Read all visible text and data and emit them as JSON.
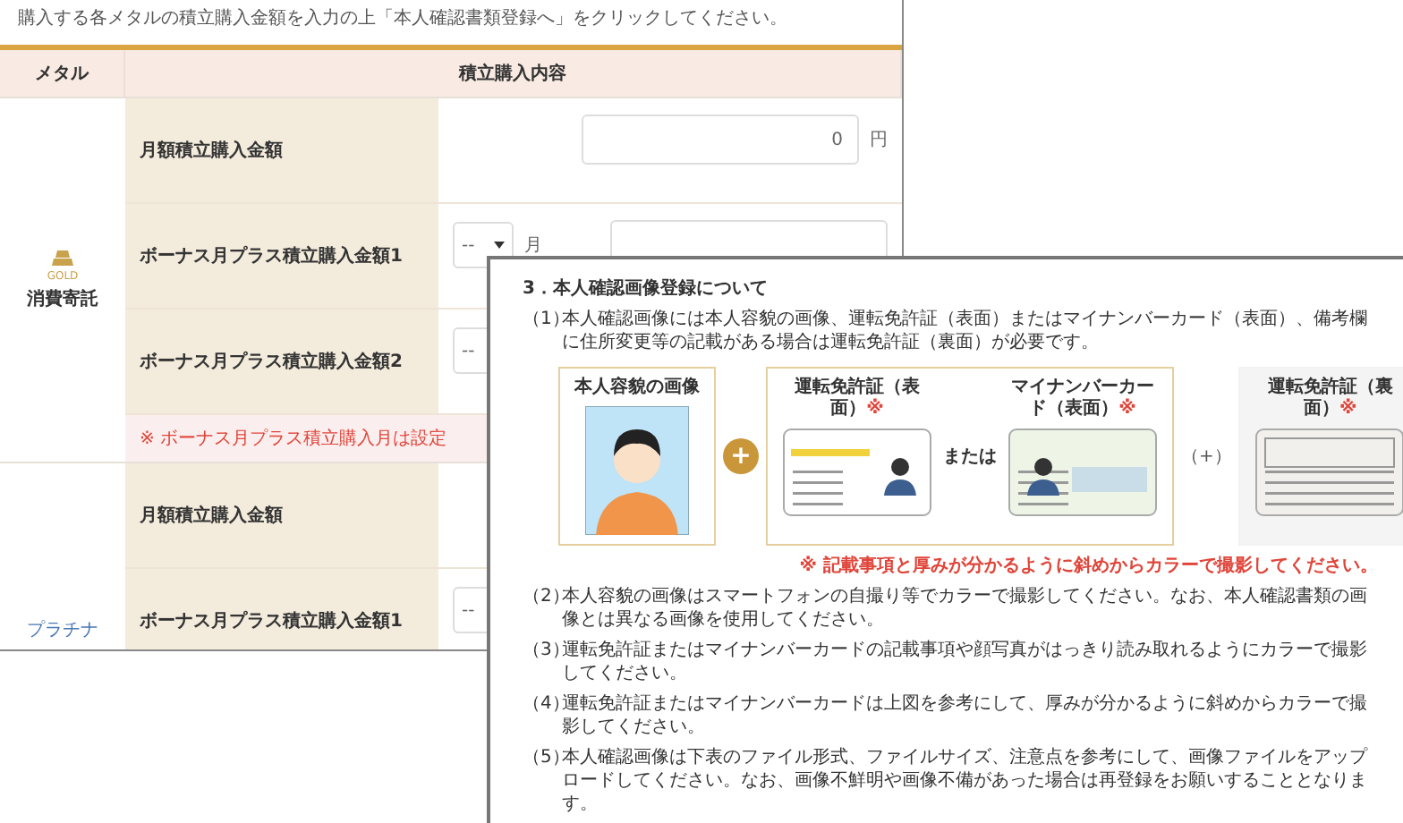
{
  "back_window": {
    "instruction": "購入する各メタルの積立購入金額を入力の上「本人確認書類登録へ」をクリックしてください。",
    "columns": [
      "メタル",
      "積立購入内容"
    ],
    "metals": [
      {
        "kind": "gold",
        "badge": "GOLD",
        "name": "消費寄託",
        "rows": [
          {
            "label": "月額積立購入金額",
            "kind": "amount",
            "amount_box": true,
            "amount": "0",
            "unit": "円"
          },
          {
            "label": "ボーナス月プラス積立購入金額1",
            "kind": "bonus",
            "month": "--",
            "month_unit": "月",
            "amount_box": true
          },
          {
            "label": "ボーナス月プラス積立購入金額2",
            "kind": "bonus",
            "month": "--",
            "amount_box": false
          }
        ],
        "note": "※ ボーナス月プラス積立購入月は設定"
      },
      {
        "kind": "platinum",
        "name": "プラチナ",
        "rows": [
          {
            "label": "月額積立購入金額",
            "kind": "amount",
            "amount_box": false
          },
          {
            "label": "ボーナス月プラス積立購入金額1",
            "kind": "bonus",
            "month": "--",
            "amount_box": false
          }
        ]
      }
    ]
  },
  "front_window": {
    "heading": "3．本人確認画像登録について",
    "intro": {
      "number": "（1）",
      "text": "本人確認画像には本人容貌の画像、運転免許証（表面）またはマイナンバーカード（表面）、備考欄に住所変更等の記載がある場合は運転免許証（裏面）が必要です。"
    },
    "figure": {
      "panels": [
        {
          "kind": "face",
          "cards": [
            {
              "title": "本人容貌の画像",
              "kind": "face"
            }
          ]
        },
        {
          "kind": "cards",
          "join": {
            "kind": "circle",
            "text": "+"
          },
          "separator": "または",
          "cards": [
            {
              "title": "運転免許証（表面）",
              "mark": "※",
              "kind": "license_front"
            },
            {
              "title": "マイナンバーカード（表面）",
              "mark": "※",
              "kind": "mynumber_front"
            }
          ]
        },
        {
          "kind": "back",
          "join": {
            "kind": "plain",
            "text": "（+）"
          },
          "cards": [
            {
              "title": "運転免許証（裏面）",
              "mark": "※",
              "kind": "license_back"
            }
          ]
        }
      ]
    },
    "figure_note": "※ 記載事項と厚みが分かるように斜めからカラーで撮影してください。",
    "items": [
      {
        "number": "（2）",
        "text": "本人容貌の画像はスマートフォンの自撮り等でカラーで撮影してください。なお、本人確認書類の画像とは異なる画像を使用してください。"
      },
      {
        "number": "（3）",
        "text": "運転免許証またはマイナンバーカードの記載事項や顔写真がはっきり読み取れるようにカラーで撮影してください。"
      },
      {
        "number": "（4）",
        "text": "運転免許証またはマイナンバーカードは上図を参考にして、厚みが分かるように斜めからカラーで撮影してください。"
      },
      {
        "number": "（5）",
        "text": "本人確認画像は下表のファイル形式、ファイルサイズ、注意点を参考にして、画像ファイルをアップロードしてください。なお、画像不鮮明や画像不備があった場合は再登録をお願いすることとなります。"
      }
    ]
  }
}
